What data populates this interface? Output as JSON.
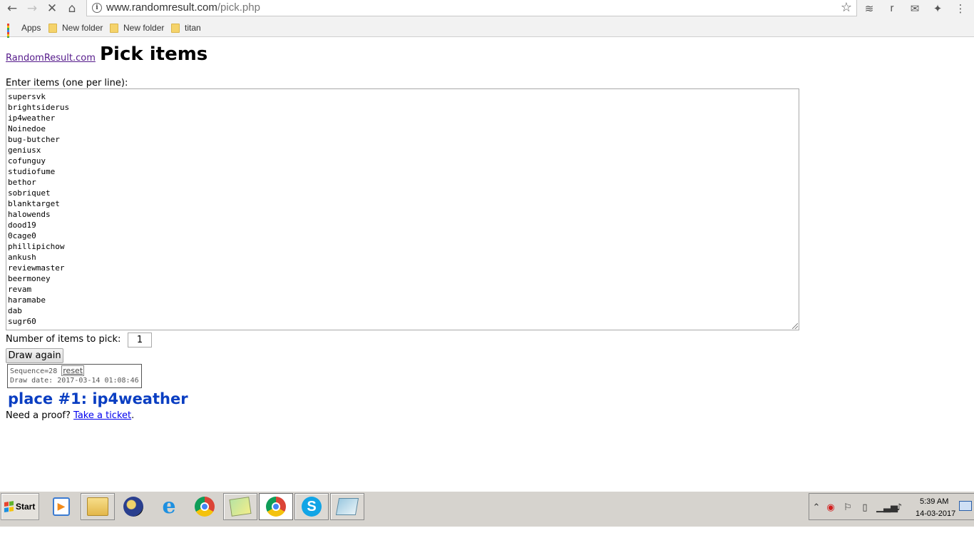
{
  "browser": {
    "url_host": "www.randomresult.com",
    "url_path": "/pick.php",
    "bookmarks": [
      {
        "label": "Apps"
      },
      {
        "label": "New folder"
      },
      {
        "label": "New folder"
      },
      {
        "label": "titan"
      }
    ],
    "extension_r_label": "r"
  },
  "page": {
    "site_link": "RandomResult.com",
    "title": "Pick items",
    "items_label": "Enter items (one per line):",
    "items": [
      "supersvk",
      "brightsiderus",
      "ip4weather",
      "Noinedoe",
      "bug-butcher",
      "geniusx",
      "cofunguy",
      "studiofume",
      "bethor",
      "sobriquet",
      "blanktarget",
      "halowends",
      "dood19",
      "0cage0",
      "phillipichow",
      "ankush",
      "reviewmaster",
      "beermoney",
      "revam",
      "haramabe",
      "dab",
      "sugr60"
    ],
    "count_label": "Number of items to pick:",
    "count_value": "1",
    "draw_button": "Draw again",
    "sequence_text": "Sequence=28",
    "reset_link": "reset",
    "draw_date": "Draw date: 2017-03-14 01:08:46",
    "result": "place #1: ip4weather",
    "proof_prefix": "Need a proof?",
    "proof_link": "Take a ticket",
    "proof_suffix": "."
  },
  "taskbar": {
    "start_label": "Start",
    "clock_time": "5:39 AM",
    "clock_date": "14-03-2017"
  },
  "colors": {
    "result_blue": "#0a3ec2",
    "visited_link": "#551a8b",
    "link": "#0000ee"
  }
}
